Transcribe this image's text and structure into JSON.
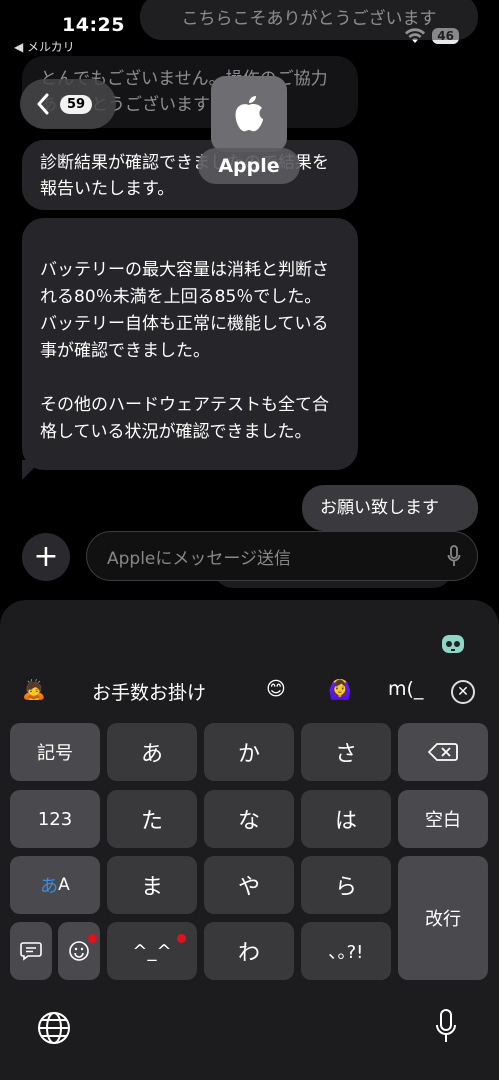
{
  "status": {
    "time": "14:25",
    "back_app": "◀ メルカリ",
    "battery": "46"
  },
  "nav": {
    "count": "59",
    "contact_name": "Apple"
  },
  "messages": {
    "out_top": "こちらこそありがとうございます",
    "in_1": "とんでもございません。操作のご協力ありがとうございます",
    "in_2": "診断結果が確認できましたので結果を報告いたします。",
    "in_3": "バッテリーの最大容量は消耗と判断される80％未満を上回る85％でした。\nバッテリー自体も正常に機能している事が確認できました。\n\nその他のハードウェアテストも全て合格している状況が確認できました。",
    "out_last": "お願い致します"
  },
  "input": {
    "placeholder": "Appleにメッセージ送信"
  },
  "keyboard": {
    "candidates": [
      "🙇",
      "お手数お掛け",
      "😊",
      "🙆‍♀️",
      "m(_"
    ],
    "keys": {
      "symbols": "記号",
      "a": "あ",
      "ka": "か",
      "sa": "さ",
      "num": "123",
      "ta": "た",
      "na": "な",
      "ha": "は",
      "space": "空白",
      "mode": "あA",
      "ma": "ま",
      "ya": "や",
      "ra": "ら",
      "enter": "改行",
      "wa": "わ",
      "face": "^_^",
      "punct": "､｡?!"
    }
  }
}
